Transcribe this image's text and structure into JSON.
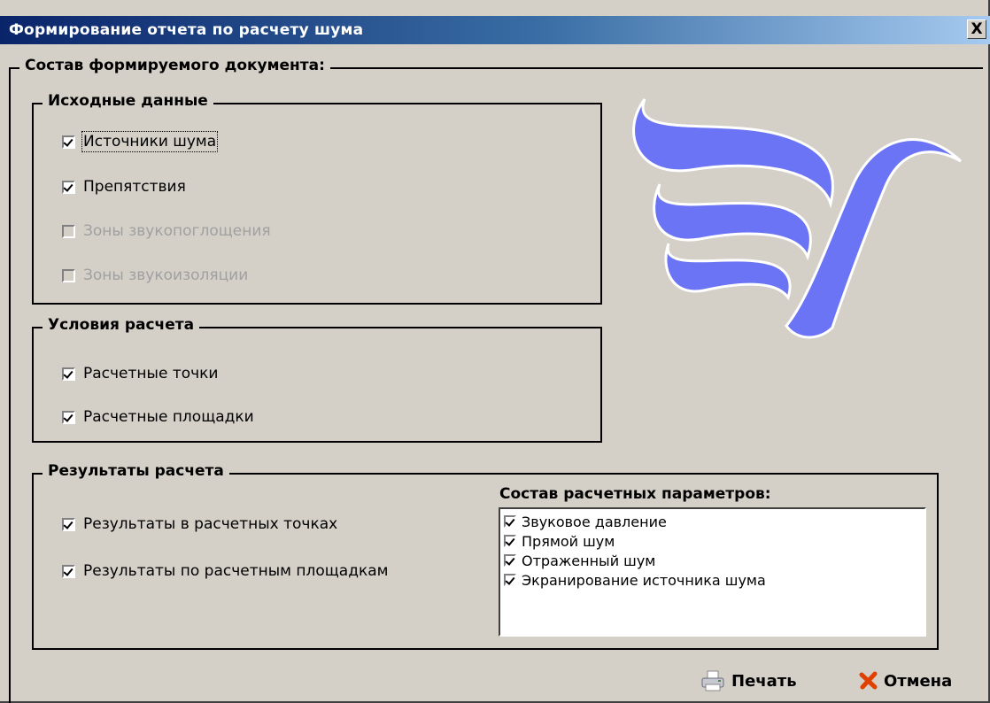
{
  "window": {
    "title": "Формирование отчета по расчету шума",
    "close_label": "X"
  },
  "composition": {
    "title": "Состав формируемого документа:"
  },
  "source_data": {
    "title": "Исходные данные",
    "items": [
      {
        "label": "Источники шума",
        "checked": true,
        "enabled": true
      },
      {
        "label": "Препятствия",
        "checked": true,
        "enabled": true
      },
      {
        "label": "Зоны звукопоглощения",
        "checked": false,
        "enabled": false
      },
      {
        "label": "Зоны звукоизоляции",
        "checked": false,
        "enabled": false
      }
    ]
  },
  "calc_conditions": {
    "title": "Условия расчета",
    "items": [
      {
        "label": "Расчетные точки",
        "checked": true
      },
      {
        "label": "Расчетные площадки",
        "checked": true
      }
    ]
  },
  "calc_results": {
    "title": "Результаты расчета",
    "items": [
      {
        "label": "Результаты в расчетных точках",
        "checked": true
      },
      {
        "label": "Результаты по расчетным площадкам",
        "checked": true
      }
    ]
  },
  "params": {
    "title": "Состав расчетных параметров:",
    "items": [
      {
        "label": "Звуковое давление",
        "checked": true
      },
      {
        "label": "Прямой шум",
        "checked": true
      },
      {
        "label": "Отраженный шум",
        "checked": true
      },
      {
        "label": "Экранирование источника шума",
        "checked": true
      }
    ]
  },
  "buttons": {
    "print_label": "Печать",
    "cancel_label": "Отмена"
  },
  "colors": {
    "logo": "#6b74f5",
    "title_bar_start": "#0a246a",
    "title_bar_end": "#a6caf0",
    "cancel_icon": "#e04000"
  }
}
